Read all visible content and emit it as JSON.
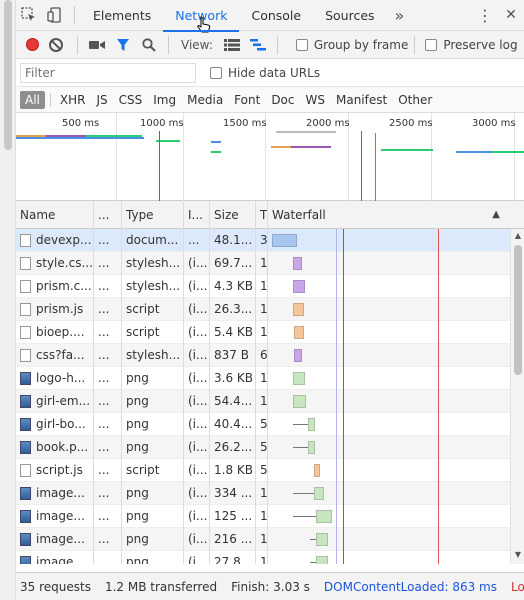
{
  "tabs": {
    "elements": "Elements",
    "network": "Network",
    "console": "Console",
    "sources": "Sources",
    "more": "»"
  },
  "toolbar": {
    "view_label": "View:",
    "group_by_frame": "Group by frame",
    "preserve_log": "Preserve log"
  },
  "filter": {
    "placeholder": "Filter",
    "hide_data_urls": "Hide data URLs"
  },
  "types": [
    "All",
    "XHR",
    "JS",
    "CSS",
    "Img",
    "Media",
    "Font",
    "Doc",
    "WS",
    "Manifest",
    "Other"
  ],
  "overview": {
    "ticks": [
      "500 ms",
      "1000 ms",
      "1500 ms",
      "2000 ms",
      "2500 ms",
      "3000 ms"
    ]
  },
  "table": {
    "headers": {
      "name": "Name",
      "dots": "...",
      "type": "Type",
      "initiator": "I...",
      "size": "Size",
      "time": "T",
      "waterfall": "Waterfall"
    },
    "rows": [
      {
        "name": "devexp...",
        "dots": "...",
        "type": "docum...",
        "init": "...",
        "size": "48.1...",
        "time": "3",
        "icon": "doc"
      },
      {
        "name": "style.cs...",
        "dots": "...",
        "type": "stylesh...",
        "init": "(i...",
        "size": "69.7...",
        "time": "1",
        "icon": "doc"
      },
      {
        "name": "prism.c...",
        "dots": "...",
        "type": "stylesh...",
        "init": "(i...",
        "size": "4.3 KB",
        "time": "1",
        "icon": "doc"
      },
      {
        "name": "prism.js",
        "dots": "...",
        "type": "script",
        "init": "(i...",
        "size": "26.3...",
        "time": "1",
        "icon": "doc"
      },
      {
        "name": "bioep....",
        "dots": "...",
        "type": "script",
        "init": "(i...",
        "size": "5.4 KB",
        "time": "1",
        "icon": "doc"
      },
      {
        "name": "css?fa...",
        "dots": "...",
        "type": "stylesh...",
        "init": "(i...",
        "size": "837 B",
        "time": "6",
        "icon": "doc"
      },
      {
        "name": "logo-h...",
        "dots": "...",
        "type": "png",
        "init": "(i...",
        "size": "3.6 KB",
        "time": "1",
        "icon": "img"
      },
      {
        "name": "girl-em...",
        "dots": "...",
        "type": "png",
        "init": "(i...",
        "size": "54.4...",
        "time": "1",
        "icon": "img"
      },
      {
        "name": "girl-bo...",
        "dots": "...",
        "type": "png",
        "init": "(i...",
        "size": "40.4...",
        "time": "5",
        "icon": "img"
      },
      {
        "name": "book.p...",
        "dots": "...",
        "type": "png",
        "init": "(i...",
        "size": "26.2...",
        "time": "5",
        "icon": "img"
      },
      {
        "name": "script.js",
        "dots": "...",
        "type": "script",
        "init": "(i...",
        "size": "1.8 KB",
        "time": "5",
        "icon": "doc"
      },
      {
        "name": "image...",
        "dots": "...",
        "type": "png",
        "init": "(i...",
        "size": "334 ...",
        "time": "1",
        "icon": "img"
      },
      {
        "name": "image...",
        "dots": "...",
        "type": "png",
        "init": "(i...",
        "size": "125 ...",
        "time": "1",
        "icon": "img"
      },
      {
        "name": "image...",
        "dots": "...",
        "type": "png",
        "init": "(i...",
        "size": "216 ...",
        "time": "1",
        "icon": "img"
      },
      {
        "name": "image...",
        "dots": "...",
        "type": "png",
        "init": "(i...",
        "size": "27.8...",
        "time": "1",
        "icon": "img"
      }
    ]
  },
  "status": {
    "requests": "35 requests",
    "transferred": "1.2 MB transferred",
    "finish": "Finish: 3.03 s",
    "dcl": "DOMContentLoaded: 863 ms",
    "load": "Loa..."
  },
  "colors": {
    "accent": "#1a73e8",
    "record": "#e53935",
    "dcl_line": "#5b5bdb",
    "load_line": "#e05555"
  }
}
